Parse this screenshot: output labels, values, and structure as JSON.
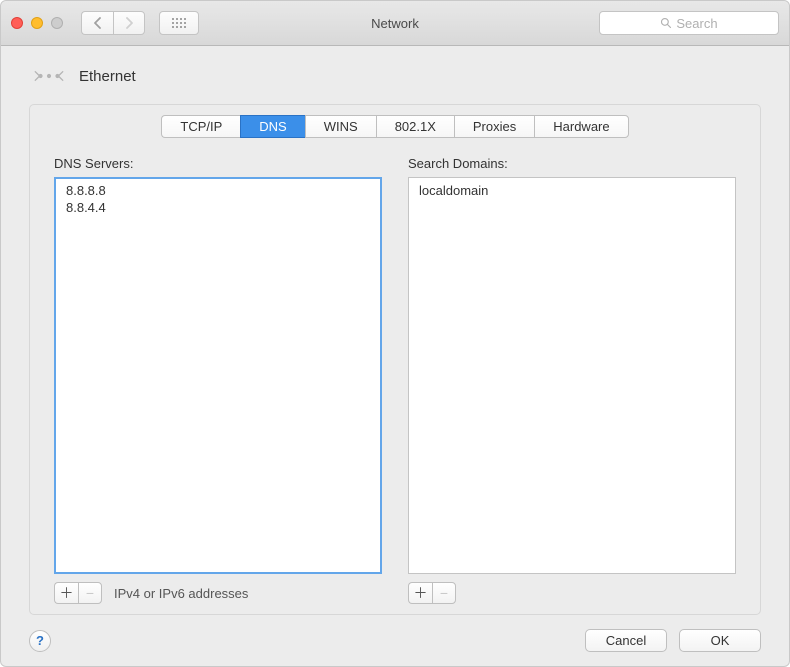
{
  "window": {
    "title": "Network"
  },
  "search": {
    "placeholder": "Search"
  },
  "header": {
    "connection_label": "Ethernet"
  },
  "tabs": {
    "items": [
      "TCP/IP",
      "DNS",
      "WINS",
      "802.1X",
      "Proxies",
      "Hardware"
    ],
    "active_index": 1
  },
  "dns": {
    "label": "DNS Servers:",
    "items": [
      "8.8.8.8",
      "8.8.4.4"
    ],
    "hint": "IPv4 or IPv6 addresses"
  },
  "domains": {
    "label": "Search Domains:",
    "items": [
      "localdomain"
    ]
  },
  "buttons": {
    "cancel": "Cancel",
    "ok": "OK"
  }
}
